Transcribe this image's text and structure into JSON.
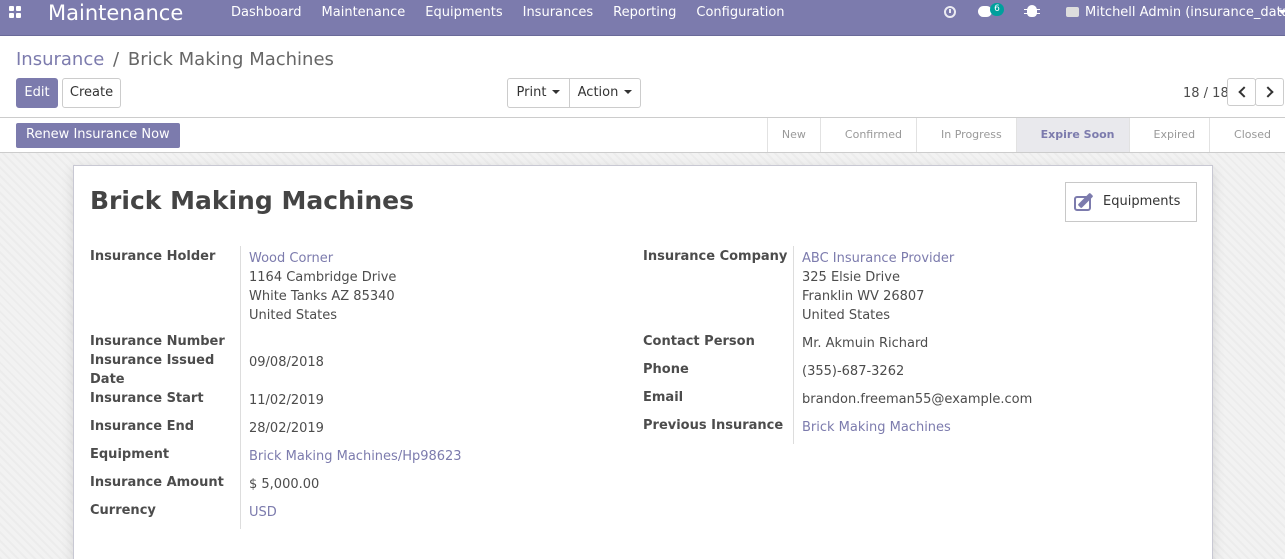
{
  "navbar": {
    "app_title": "Maintenance",
    "menu": [
      "Dashboard",
      "Maintenance",
      "Equipments",
      "Insurances",
      "Reporting",
      "Configuration"
    ],
    "chat_count": "6",
    "user": "Mitchell Admin (insurance_data)"
  },
  "breadcrumb": {
    "parent": "Insurance",
    "separator": "/",
    "current": "Brick Making Machines"
  },
  "buttons": {
    "edit": "Edit",
    "create": "Create",
    "print": "Print",
    "action": "Action"
  },
  "pager": {
    "value": "18 / 18"
  },
  "statusbar": {
    "renew": "Renew Insurance Now",
    "stages": [
      "New",
      "Confirmed",
      "In Progress",
      "Expire Soon",
      "Expired",
      "Closed"
    ],
    "active_stage": "Expire Soon"
  },
  "record": {
    "title": "Brick Making Machines",
    "smart_button": "Equipments",
    "left": {
      "holder_label": "Insurance Holder",
      "holder_name": "Wood Corner",
      "holder_addr1": "1164 Cambridge Drive",
      "holder_addr2": "White Tanks AZ 85340",
      "holder_addr3": "United States",
      "number_label": "Insurance Number",
      "issued_label_1": "Insurance Issued",
      "issued_label_2": "Date",
      "issued_value": "09/08/2018",
      "start_label": "Insurance Start",
      "start_value": "11/02/2019",
      "end_label": "Insurance End",
      "end_value": "28/02/2019",
      "equipment_label": "Equipment",
      "equipment_value": "Brick Making Machines/Hp98623",
      "amount_label": "Insurance Amount",
      "amount_value": "$ 5,000.00",
      "currency_label": "Currency",
      "currency_value": "USD"
    },
    "right": {
      "company_label": "Insurance Company",
      "company_name": "ABC Insurance Provider",
      "company_addr1": "325 Elsie Drive",
      "company_addr2": "Franklin WV 26807",
      "company_addr3": "United States",
      "contact_label": "Contact Person",
      "contact_value": "Mr. Akmuin Richard",
      "phone_label": "Phone",
      "phone_value": "(355)-687-3262",
      "email_label": "Email",
      "email_value": "brandon.freeman55@example.com",
      "previous_label": "Previous Insurance",
      "previous_value": "Brick Making Machines"
    }
  }
}
